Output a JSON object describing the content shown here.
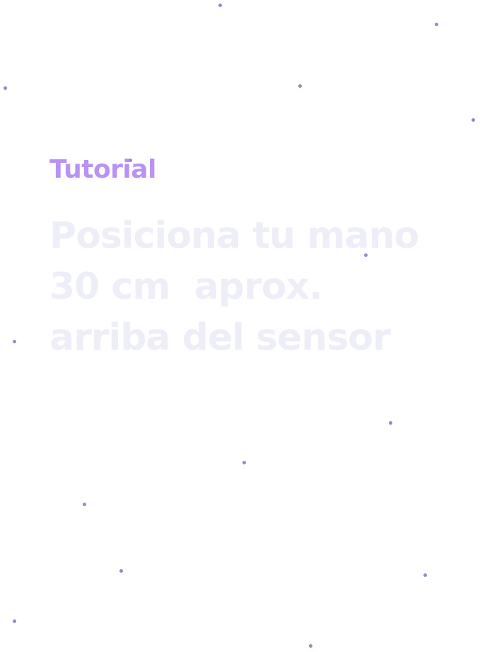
{
  "tutorial": {
    "eyebrow": "Tutorial",
    "headline_lines": [
      "Posiciona tu mano",
      "30 cm  aprox.",
      "arriba del sensor"
    ]
  },
  "colors": {
    "eyebrow": "#b892f4",
    "headline": "#eeeef8",
    "stars": "#9b86c7",
    "background": "#ffffff"
  }
}
